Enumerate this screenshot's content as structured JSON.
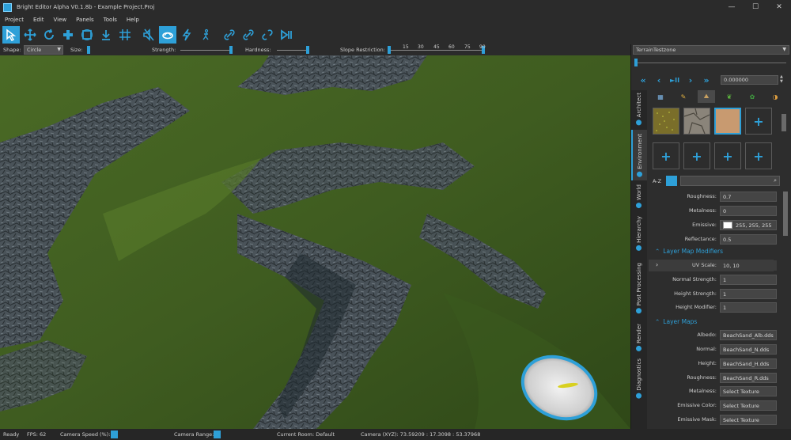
{
  "window": {
    "title": "Bright Editor Alpha V0.1.8b - Example Project.Proj",
    "minimize": "—",
    "maximize": "☐",
    "close": "✕"
  },
  "menu": [
    "Project",
    "Edit",
    "View",
    "Panels",
    "Tools",
    "Help"
  ],
  "toolbar": {
    "active_tools": [
      "select",
      "brush-circle"
    ]
  },
  "options": {
    "shape_label": "Shape:",
    "shape_value": "Circle",
    "size_label": "Size:",
    "strength_label": "Strength:",
    "hardness_label": "Hardness:",
    "slope_label": "Slope Restriction:",
    "slope_ticks": [
      "15",
      "30",
      "45",
      "60",
      "75",
      "90"
    ],
    "slope_range": [
      0,
      90
    ]
  },
  "right_panel": {
    "zone": "TerrainTestzone",
    "time_value": "0.000000",
    "tabs": [
      "Architect",
      "Environment",
      "World",
      "Hierarchy",
      "Post Processing",
      "Render",
      "Diagnostics"
    ],
    "active_tab": "Environment",
    "az_label": "A-Z",
    "properties": [
      {
        "label": "Roughness:",
        "value": "0.7"
      },
      {
        "label": "Metalness:",
        "value": "0"
      },
      {
        "label": "Emissive:",
        "value": "255, 255, 255",
        "swatch": "#ffffff"
      },
      {
        "label": "Reflectance:",
        "value": "0.5"
      }
    ],
    "modifiers_header": "Layer Map Modifiers",
    "modifiers": [
      {
        "label": "UV Scale:",
        "value": "10, 10"
      },
      {
        "label": "Normal Strength:",
        "value": "1"
      },
      {
        "label": "Height Strength:",
        "value": "1"
      },
      {
        "label": "Height Modifier:",
        "value": "1"
      }
    ],
    "maps_header": "Layer Maps",
    "maps": [
      {
        "label": "Albedo:",
        "value": "BeachSand_Alb.dds"
      },
      {
        "label": "Normal:",
        "value": "BeachSand_N.dds"
      },
      {
        "label": "Height:",
        "value": "BeachSand_H.dds"
      },
      {
        "label": "Roughness:",
        "value": "BeachSand_R.dds"
      },
      {
        "label": "Metalness:",
        "value": "Select Texture"
      },
      {
        "label": "Emissive Color:",
        "value": "Select Texture"
      },
      {
        "label": "Emissive Mask:",
        "value": "Select Texture"
      }
    ]
  },
  "status": {
    "ready": "Ready",
    "fps": "FPS: 62",
    "camera_speed": "Camera  Speed (%):",
    "camera_range": "Camera Range:",
    "current_room": "Current Room: Default",
    "camera_xyz": "Camera (XYZ):  73.59209 : 17.3098 : 53.37968"
  },
  "colors": {
    "accent": "#2ea0d8",
    "panel": "#2d2d2d",
    "toolbar": "#2b2b2b"
  }
}
